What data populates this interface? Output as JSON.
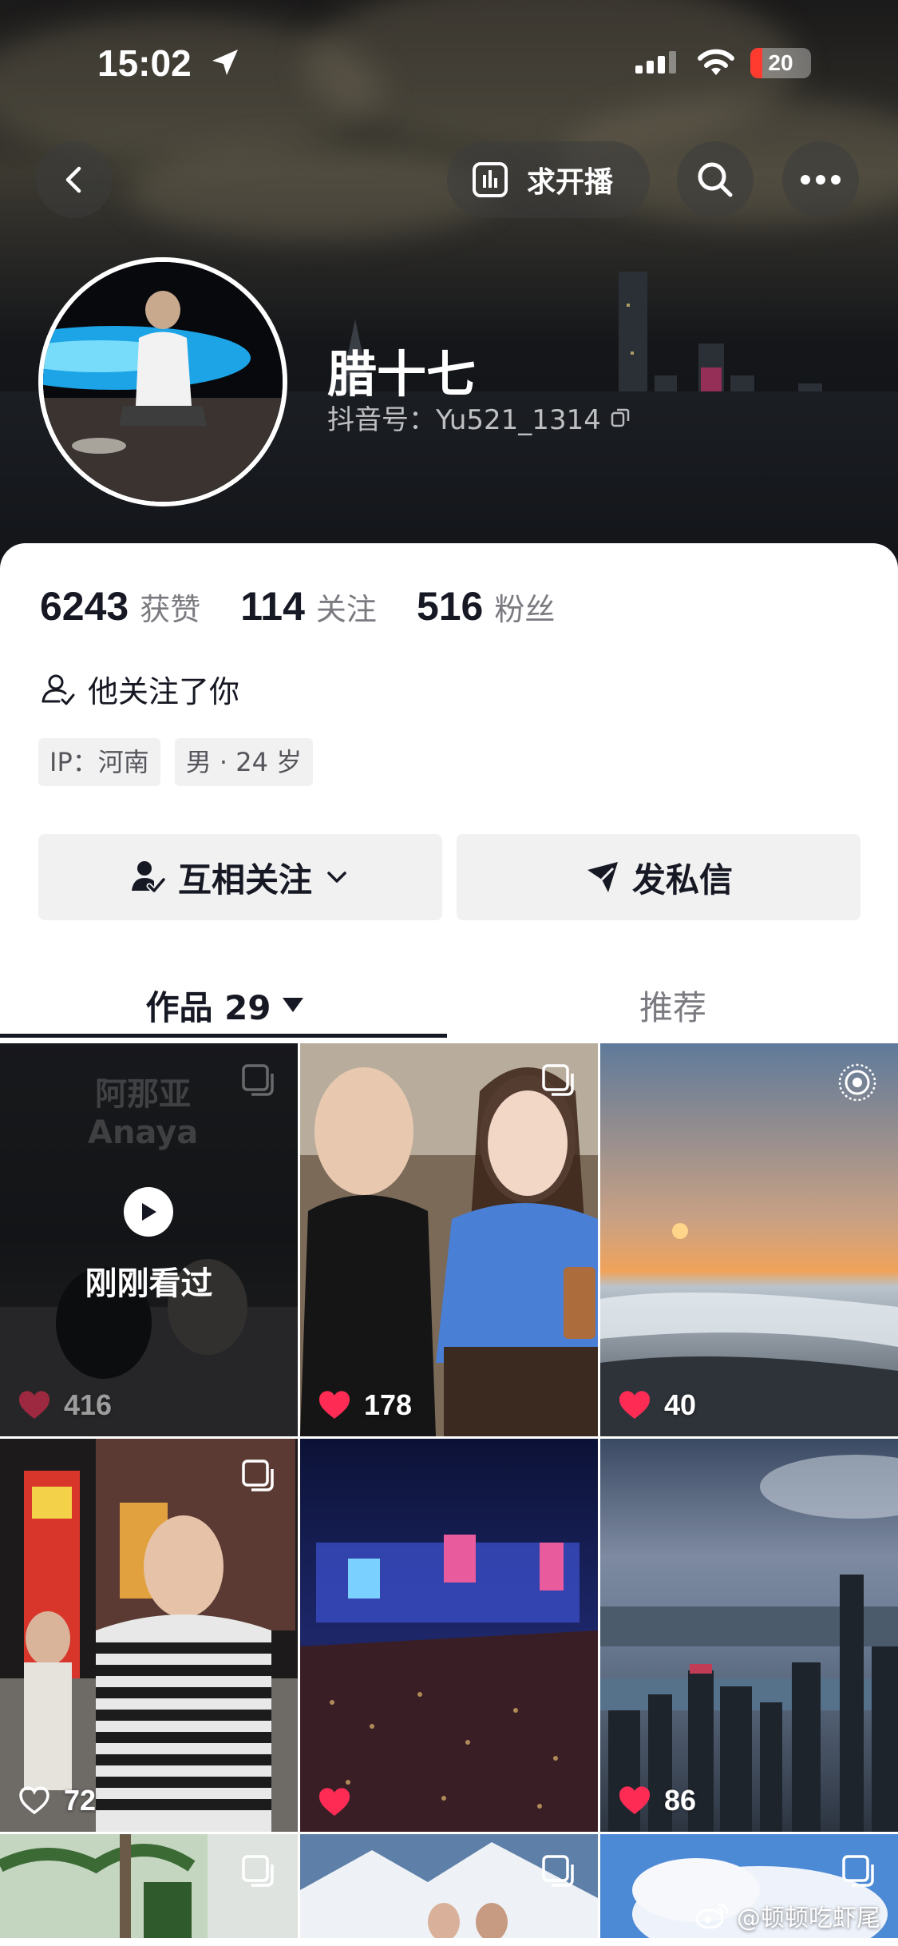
{
  "status_bar": {
    "time": "15:02",
    "battery": "20",
    "battery_level": 0.2
  },
  "header": {
    "live_request_label": "求开播"
  },
  "profile": {
    "name": "腊十七",
    "douyin_id": "抖音号：Yu521_1314",
    "stats": [
      {
        "value": "6243",
        "label": "获赞"
      },
      {
        "value": "114",
        "label": "关注"
      },
      {
        "value": "516",
        "label": "粉丝"
      }
    ],
    "follows_you": "他关注了你",
    "tags": [
      "IP：河南",
      "男 · 24 岁"
    ]
  },
  "actions": {
    "mutual_follow": "互相关注",
    "message": "发私信"
  },
  "tabs": {
    "works": "作品 29",
    "recommend": "推荐"
  },
  "grid": {
    "first_tile_wm_line1": "阿那亚",
    "first_tile_wm_line2": "Anaya",
    "just_watched": "刚刚看过",
    "items": [
      {
        "likes": "416",
        "liked": true
      },
      {
        "likes": "178",
        "liked": true
      },
      {
        "likes": "40",
        "liked": true
      },
      {
        "likes": "72",
        "liked": false
      },
      {
        "likes": "",
        "liked": true
      },
      {
        "likes": "86",
        "liked": true
      }
    ]
  },
  "watermark": "@顿顿吃虾尾",
  "colors": {
    "like_red": "#fe2c55",
    "text": "#161823",
    "muted": "#7a7a80",
    "chip_bg": "#f1f1f2"
  }
}
